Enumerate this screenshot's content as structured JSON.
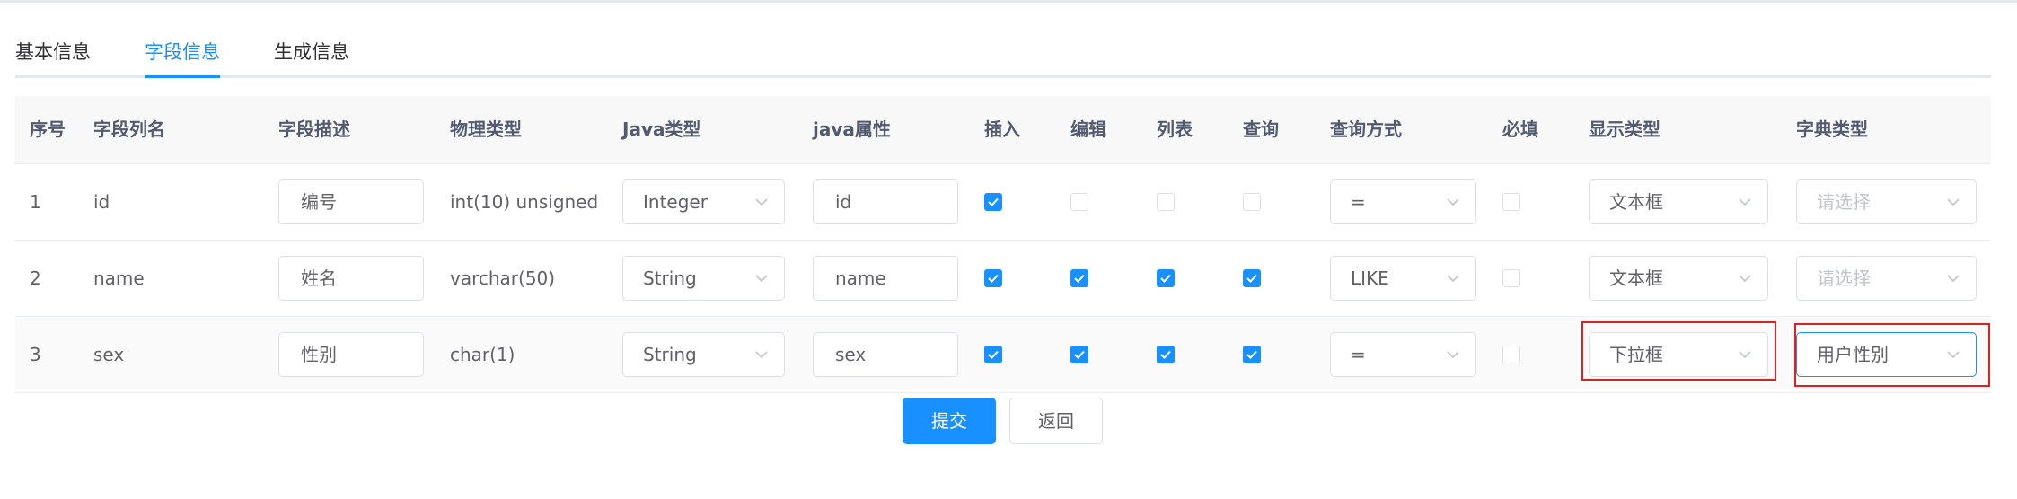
{
  "tabs": [
    {
      "label": "基本信息",
      "active": false
    },
    {
      "label": "字段信息",
      "active": true
    },
    {
      "label": "生成信息",
      "active": false
    }
  ],
  "columns": [
    "序号",
    "字段列名",
    "字段描述",
    "物理类型",
    "Java类型",
    "java属性",
    "插入",
    "编辑",
    "列表",
    "查询",
    "查询方式",
    "必填",
    "显示类型",
    "字典类型"
  ],
  "rows": [
    {
      "index": "1",
      "column": "id",
      "desc": "编号",
      "physical": "int(10) unsigned",
      "java_type": "Integer",
      "java_field": "id",
      "insert": true,
      "edit": false,
      "list": false,
      "query": false,
      "query_type": "=",
      "required": false,
      "html_type": "文本框",
      "dict_type": "请选择",
      "dict_placeholder": true
    },
    {
      "index": "2",
      "column": "name",
      "desc": "姓名",
      "physical": "varchar(50)",
      "java_type": "String",
      "java_field": "name",
      "insert": true,
      "edit": true,
      "list": true,
      "query": true,
      "query_type": "LIKE",
      "required": false,
      "html_type": "文本框",
      "dict_type": "请选择",
      "dict_placeholder": true
    },
    {
      "index": "3",
      "column": "sex",
      "desc": "性别",
      "physical": "char(1)",
      "java_type": "String",
      "java_field": "sex",
      "insert": true,
      "edit": true,
      "list": true,
      "query": true,
      "query_type": "=",
      "required": false,
      "html_type": "下拉框",
      "dict_type": "用户性别",
      "dict_placeholder": false
    }
  ],
  "buttons": {
    "submit": "提交",
    "back": "返回"
  },
  "colors": {
    "accent": "#1890ff",
    "highlight": "#e02020",
    "border": "#dcdfe6"
  },
  "icons": {
    "select_arrow": "chevron-down-icon",
    "check": "check-icon"
  }
}
